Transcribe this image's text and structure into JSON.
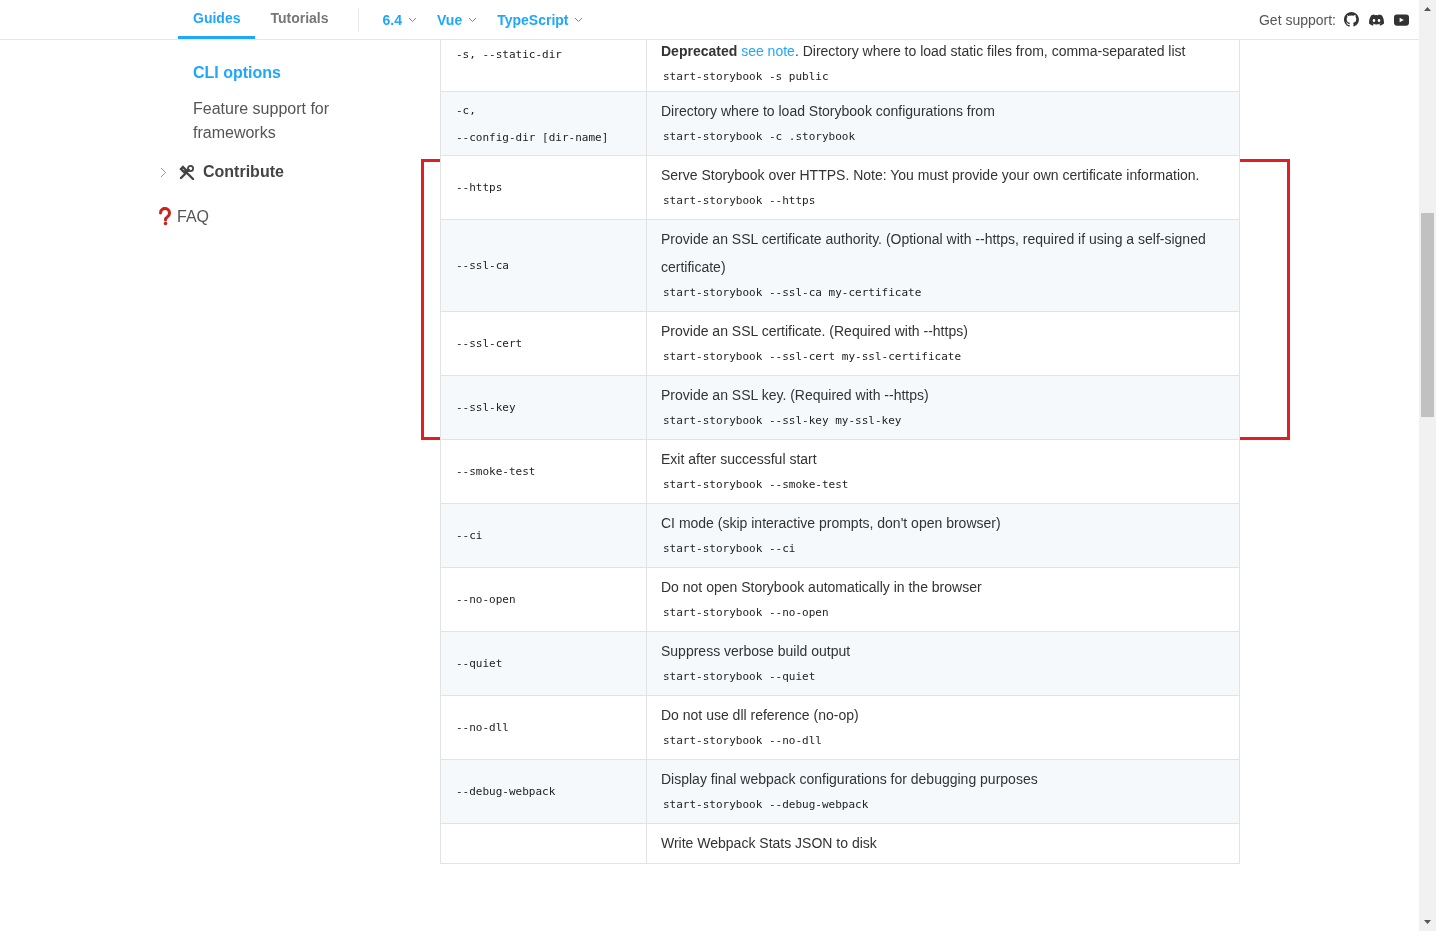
{
  "header": {
    "tabs": [
      {
        "label": "Guides",
        "selected": true
      },
      {
        "label": "Tutorials",
        "selected": false
      }
    ],
    "dropdowns": [
      {
        "label": "6.4"
      },
      {
        "label": "Vue"
      },
      {
        "label": "TypeScript"
      }
    ],
    "support_label": "Get support:"
  },
  "sidebar": {
    "items": [
      {
        "label": "CLI options",
        "selected": true
      },
      {
        "label": "Feature support for frameworks",
        "selected": false
      }
    ],
    "sections": [
      {
        "label": "Contribute",
        "kind": "expandable"
      },
      {
        "label": "FAQ",
        "kind": "faq"
      }
    ]
  },
  "table": {
    "rows": [
      {
        "option": [
          "-s, --static-dir"
        ],
        "deprecated_label": "Deprecated",
        "link": "see note",
        "description": ". Directory where to load static files from, comma-separated list",
        "example": "start-storybook -s public",
        "highlighted": false
      },
      {
        "option": [
          "-c,",
          "--config-dir [dir-name]"
        ],
        "description": "Directory where to load Storybook configurations from",
        "example": "start-storybook -c .storybook",
        "highlighted": false
      },
      {
        "option": [
          "--https"
        ],
        "description": "Serve Storybook over HTTPS. Note: You must provide your own certificate information.",
        "example": "start-storybook --https",
        "highlighted": true
      },
      {
        "option": [
          "--ssl-ca"
        ],
        "description": "Provide an SSL certificate authority. (Optional with --https, required if using a self-signed certificate)",
        "example": "start-storybook --ssl-ca my-certificate",
        "highlighted": true
      },
      {
        "option": [
          "--ssl-cert"
        ],
        "description": "Provide an SSL certificate. (Required with --https)",
        "example": "start-storybook --ssl-cert my-ssl-certificate",
        "highlighted": true
      },
      {
        "option": [
          "--ssl-key"
        ],
        "description": "Provide an SSL key. (Required with --https)",
        "example": "start-storybook --ssl-key my-ssl-key",
        "highlighted": true
      },
      {
        "option": [
          "--smoke-test"
        ],
        "description": "Exit after successful start",
        "example": "start-storybook --smoke-test",
        "highlighted": false
      },
      {
        "option": [
          "--ci"
        ],
        "description": "CI mode (skip interactive prompts, don't open browser)",
        "example": "start-storybook --ci",
        "highlighted": false
      },
      {
        "option": [
          "--no-open"
        ],
        "description": "Do not open Storybook automatically in the browser",
        "example": "start-storybook --no-open",
        "highlighted": false
      },
      {
        "option": [
          "--quiet"
        ],
        "description": "Suppress verbose build output",
        "example": "start-storybook --quiet",
        "highlighted": false
      },
      {
        "option": [
          "--no-dll"
        ],
        "description": "Do not use dll reference (no-op)",
        "example": "start-storybook --no-dll",
        "highlighted": false
      },
      {
        "option": [
          "--debug-webpack"
        ],
        "description": "Display final webpack configurations for debugging purposes",
        "example": "start-storybook --debug-webpack",
        "highlighted": false
      },
      {
        "option": [],
        "description": "Write Webpack Stats JSON to disk",
        "highlighted": false
      }
    ]
  }
}
